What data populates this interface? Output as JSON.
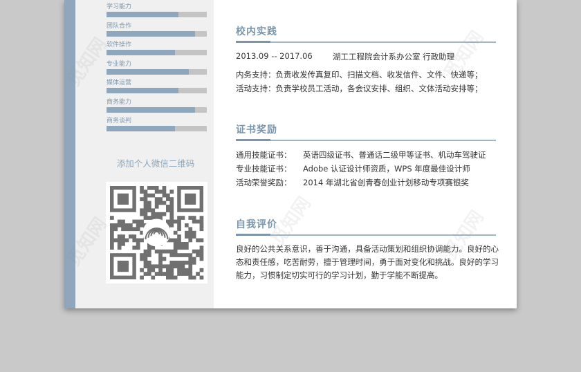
{
  "skills": [
    {
      "label": "学习能力",
      "level": 0.72
    },
    {
      "label": "团队合作",
      "level": 0.88
    },
    {
      "label": "软件操作",
      "level": 0.68
    },
    {
      "label": "专业能力",
      "level": 0.82
    },
    {
      "label": "媒体运营",
      "level": 0.72
    },
    {
      "label": "商务能力",
      "level": 0.88
    },
    {
      "label": "商务谈判",
      "level": 0.68
    }
  ],
  "wechat_text": "添加个人微信二维码",
  "sections": {
    "practice": {
      "title": "校内实践",
      "date": "2013.09 -- 2017.06",
      "org": "湖工工程院会计系办公室  行政助理",
      "lines": [
        "内务支持：负责收发传真复印、扫描文档、收发信件、文件、快递等；",
        "活动支持：负责学校员工活动，各会议安排、组织、文体活动安排等；"
      ]
    },
    "certs": {
      "title": "证书奖励",
      "rows": [
        {
          "k": "通用技能证书：",
          "v": "英语四级证书、普通话二级甲等证书、机动车驾驶证"
        },
        {
          "k": "专业技能证书：",
          "v": "Adobe 认证设计师资质，WPS 年度最佳设计师"
        },
        {
          "k": "活动荣誉奖励：",
          "v": "2014 年湖北省创青春创业计划移动专项赛银奖"
        }
      ]
    },
    "self": {
      "title": "自我评价",
      "text": "良好的公共关系意识，善于沟通，具备活动策划和组织协调能力。良好的心态和责任感，吃苦耐劳，擅于管理时间，勇于面对变化和挑战。良好的学习能力，习惯制定切实可行的学习计划，勤于学能不断提高。"
    }
  },
  "watermark": "觅知网",
  "colors": {
    "accent": "#8ea7bc",
    "bar_bg": "#c4c4c4",
    "title": "#7b96ac"
  }
}
